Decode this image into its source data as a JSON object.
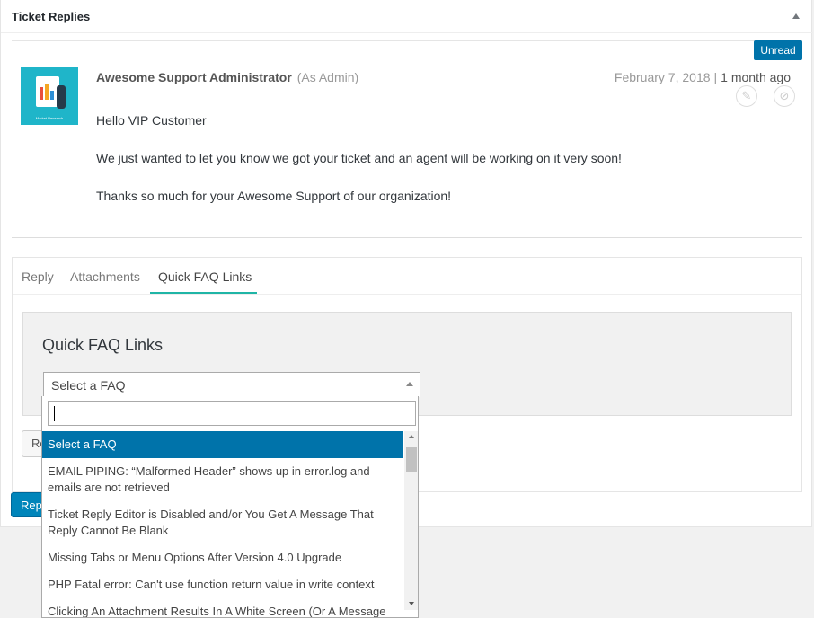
{
  "panel": {
    "title": "Ticket Replies"
  },
  "reply": {
    "badge": "Unread",
    "author": "Awesome Support Administrator",
    "role": "(As Admin)",
    "date": "February 7, 2018",
    "separator": "|",
    "relative_time": "1 month ago",
    "avatar_caption": "Market Research",
    "lines": [
      "Hello VIP Customer",
      "We just wanted to let you know we got your ticket and an agent will be working on it very soon!",
      "Thanks so much for your Awesome Support of our organization!"
    ]
  },
  "tabs": [
    {
      "label": "Reply",
      "active": false
    },
    {
      "label": "Attachments",
      "active": false
    },
    {
      "label": "Quick FAQ Links",
      "active": true
    }
  ],
  "faq": {
    "heading": "Quick FAQ Links",
    "selected": "Select a FAQ",
    "search_value": "",
    "options": [
      "Select a FAQ",
      "EMAIL PIPING: “Malformed Header” shows up in error.log and emails are not retrieved",
      "Ticket Reply Editor is Disabled and/or You Get A Message That Reply Cannot Be Blank",
      "Missing Tabs or Menu Options After Version 4.0 Upgrade",
      "PHP Fatal error: Can't use function return value in write context",
      "Clicking An Attachment Results In A White Screen (Or A Message"
    ]
  },
  "buttons": {
    "secondary_label": "Re",
    "primary_label": "Rep"
  }
}
